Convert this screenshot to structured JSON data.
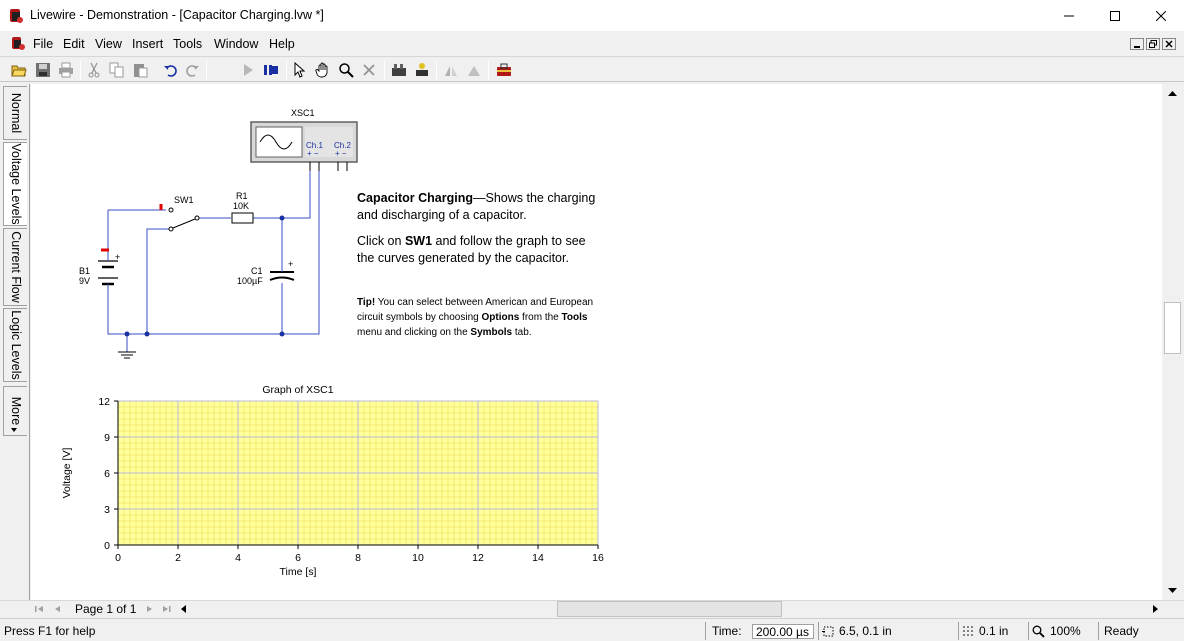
{
  "window": {
    "title": "Livewire - Demonstration - [Capacitor Charging.lvw *]"
  },
  "menu": [
    "File",
    "Edit",
    "View",
    "Insert",
    "Tools",
    "Window",
    "Help"
  ],
  "side_tabs": [
    "Normal",
    "Voltage Levels",
    "Current Flow",
    "Logic Levels",
    "More"
  ],
  "circuit": {
    "scope_label": "XSC1",
    "ch1": "Ch.1",
    "ch2": "Ch.2",
    "plus_minus": "+ −",
    "switch_label": "SW1",
    "resistor_label": "R1",
    "resistor_value": "10K",
    "battery_label": "B1",
    "battery_value": "9V",
    "capacitor_label": "C1",
    "capacitor_value": "100µF",
    "plus": "+"
  },
  "description": {
    "heading": "Capacitor Charging",
    "line1_rest": "—Shows the charging",
    "line2": "and discharging of a capacitor.",
    "line3_pre": "Click on ",
    "line3_bold": "SW1",
    "line3_post": " and follow the graph to see",
    "line4": "the curves generated by the capacitor."
  },
  "tip": {
    "bold": "Tip!",
    "l1": " You can select between American and European",
    "l2_pre": "circuit symbols by choosing ",
    "l2_b1": "Options",
    "l2_mid": " from the ",
    "l2_b2": "Tools",
    "l3_pre": "menu and clicking on the ",
    "l3_b": "Symbols",
    "l3_post": " tab."
  },
  "chart_data": {
    "type": "line",
    "title": "Graph of XSC1",
    "xlabel": "Time [s]",
    "ylabel": "Voltage [V]",
    "xlim": [
      0,
      16
    ],
    "ylim": [
      0,
      12
    ],
    "xticks": [
      0,
      2,
      4,
      6,
      8,
      10,
      12,
      14,
      16
    ],
    "yticks": [
      0,
      3,
      6,
      9,
      12
    ],
    "grid": true,
    "series": [],
    "plot_background": "#ffff9c",
    "grid_color": "#e8d84a"
  },
  "pager": {
    "page": "Page 1 of 1"
  },
  "status": {
    "help": "Press F1 for help",
    "time_label": "Time:",
    "time_value": "200.00 µs",
    "position": "6.5, 0.1 in",
    "grid": "0.1 in",
    "zoom": "100%",
    "state": "Ready"
  }
}
